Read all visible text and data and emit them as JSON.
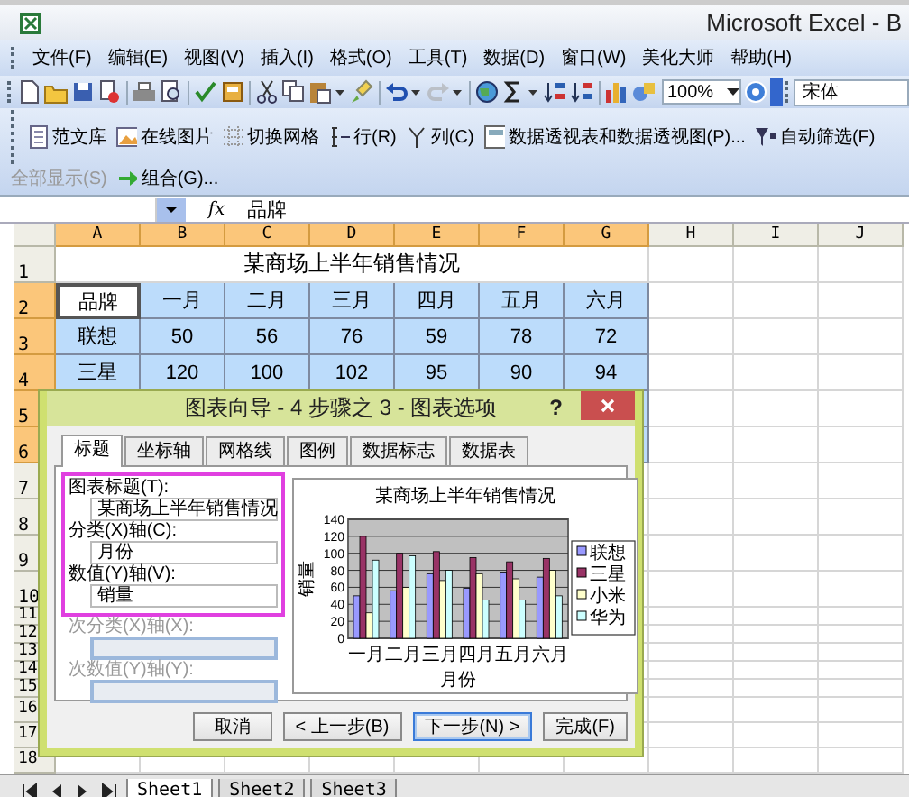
{
  "window": {
    "title": "Microsoft Excel - B"
  },
  "menu": [
    "文件(F)",
    "编辑(E)",
    "视图(V)",
    "插入(I)",
    "格式(O)",
    "工具(T)",
    "数据(D)",
    "窗口(W)",
    "美化大师",
    "帮助(H)"
  ],
  "toolbar": {
    "zoom": "100%",
    "font": "宋体"
  },
  "toolbar2": [
    {
      "label": "范文库",
      "disabled": false
    },
    {
      "label": "在线图片",
      "disabled": false
    },
    {
      "label": "切换网格",
      "disabled": false
    },
    {
      "label": "行(R)",
      "disabled": false
    },
    {
      "label": "列(C)",
      "disabled": false
    },
    {
      "label": "数据透视表和数据透视图(P)...",
      "disabled": false
    },
    {
      "label": "自动筛选(F)",
      "disabled": false
    },
    {
      "label": "全部显示(S)",
      "disabled": true
    },
    {
      "label": "组合(G)...",
      "disabled": false
    }
  ],
  "formula_bar": {
    "function_symbol": "fx",
    "content": "品牌"
  },
  "sheet": {
    "columns": [
      {
        "label": "A",
        "selected": true
      },
      {
        "label": "B",
        "selected": true
      },
      {
        "label": "C",
        "selected": true
      },
      {
        "label": "D",
        "selected": true
      },
      {
        "label": "E",
        "selected": true
      },
      {
        "label": "F",
        "selected": true
      },
      {
        "label": "G",
        "selected": true
      },
      {
        "label": "H",
        "selected": false
      },
      {
        "label": "I",
        "selected": false
      },
      {
        "label": "J",
        "selected": false
      }
    ],
    "rows": [
      {
        "header": "1",
        "selected": false,
        "kind": "title",
        "text": "某商场上半年销售情况"
      },
      {
        "header": "2",
        "selected": true,
        "kind": "data",
        "cells": [
          {
            "text": "品牌",
            "active": true
          },
          {
            "text": "一月",
            "active": false
          },
          {
            "text": "二月",
            "active": false
          },
          {
            "text": "三月",
            "active": false
          },
          {
            "text": "四月",
            "active": false
          },
          {
            "text": "五月",
            "active": false
          },
          {
            "text": "六月",
            "active": false
          }
        ]
      },
      {
        "header": "3",
        "selected": true,
        "kind": "data",
        "cells": [
          {
            "text": "联想",
            "active": false
          },
          {
            "text": "50",
            "active": false
          },
          {
            "text": "56",
            "active": false
          },
          {
            "text": "76",
            "active": false
          },
          {
            "text": "59",
            "active": false
          },
          {
            "text": "78",
            "active": false
          },
          {
            "text": "72",
            "active": false
          }
        ]
      },
      {
        "header": "4",
        "selected": true,
        "kind": "data",
        "cells": [
          {
            "text": "三星",
            "active": false
          },
          {
            "text": "120",
            "active": false
          },
          {
            "text": "100",
            "active": false
          },
          {
            "text": "102",
            "active": false
          },
          {
            "text": "95",
            "active": false
          },
          {
            "text": "90",
            "active": false
          },
          {
            "text": "94",
            "active": false
          }
        ]
      },
      {
        "header": "5",
        "selected": true,
        "kind": "data"
      },
      {
        "header": "6",
        "selected": true,
        "kind": "data"
      },
      {
        "header": "7",
        "selected": false,
        "kind": "data"
      },
      {
        "header": "8",
        "selected": false,
        "kind": "data"
      },
      {
        "header": "9",
        "selected": false,
        "kind": "data"
      },
      {
        "header": "10",
        "selected": false,
        "kind": "data"
      },
      {
        "header": "11",
        "selected": false,
        "kind": "data"
      },
      {
        "header": "12",
        "selected": false,
        "kind": "data"
      },
      {
        "header": "13",
        "selected": false,
        "kind": "data"
      },
      {
        "header": "14",
        "selected": false,
        "kind": "data"
      },
      {
        "header": "15",
        "selected": false,
        "kind": "data"
      },
      {
        "header": "16",
        "selected": false,
        "kind": "data"
      },
      {
        "header": "17",
        "selected": false,
        "kind": "data"
      },
      {
        "header": "18",
        "selected": false,
        "kind": "data"
      }
    ]
  },
  "dialog": {
    "title": "图表向导 - 4 步骤之 3 - 图表选项",
    "help": "?",
    "tabs": [
      {
        "label": "标题",
        "selected": true
      },
      {
        "label": "坐标轴",
        "selected": false
      },
      {
        "label": "网格线",
        "selected": false
      },
      {
        "label": "图例",
        "selected": false
      },
      {
        "label": "数据标志",
        "selected": false
      },
      {
        "label": "数据表",
        "selected": false
      }
    ],
    "fields": [
      {
        "label": "图表标题(T):",
        "value": "某商场上半年销售情况",
        "disabled": false,
        "highlighted": true
      },
      {
        "label": "分类(X)轴(C):",
        "value": "月份",
        "disabled": false,
        "highlighted": true
      },
      {
        "label": "数值(Y)轴(V):",
        "value": "销量",
        "disabled": false,
        "highlighted": true
      },
      {
        "label": "次分类(X)轴(X):",
        "disabled": true,
        "highlighted": false
      },
      {
        "label": "次数值(Y)轴(Y):",
        "disabled": true,
        "highlighted": false
      }
    ],
    "chart_data": {
      "type": "bar",
      "title": "某商场上半年销售情况",
      "xlabel": "月份",
      "ylabel": "销量",
      "categories": [
        "一月",
        "二月",
        "三月",
        "四月",
        "五月",
        "六月"
      ],
      "series": [
        {
          "name": "联想",
          "color": "#9999ff",
          "values": [
            50,
            56,
            76,
            59,
            78,
            72
          ]
        },
        {
          "name": "三星",
          "color": "#993366",
          "values": [
            120,
            100,
            102,
            95,
            90,
            94
          ]
        },
        {
          "name": "小米",
          "color": "#ffffcc",
          "values": [
            30,
            60,
            68,
            76,
            70,
            80
          ]
        },
        {
          "name": "华为",
          "color": "#ccffff",
          "values": [
            92,
            97,
            80,
            45,
            45,
            50
          ]
        }
      ],
      "ylim": [
        0,
        140
      ],
      "yticks": [
        0,
        20,
        40,
        60,
        80,
        100,
        120,
        140
      ],
      "grid": true,
      "legend": "right"
    },
    "buttons": [
      {
        "label": "取消",
        "default": false
      },
      {
        "label": "< 上一步(B)",
        "default": false
      },
      {
        "label": "下一步(N) >",
        "default": true
      },
      {
        "label": "完成(F)",
        "default": false
      }
    ]
  },
  "sheet_tabs": [
    {
      "label": "Sheet1",
      "selected": true
    },
    {
      "label": "Sheet2",
      "selected": false
    },
    {
      "label": "Sheet3",
      "selected": false
    }
  ]
}
